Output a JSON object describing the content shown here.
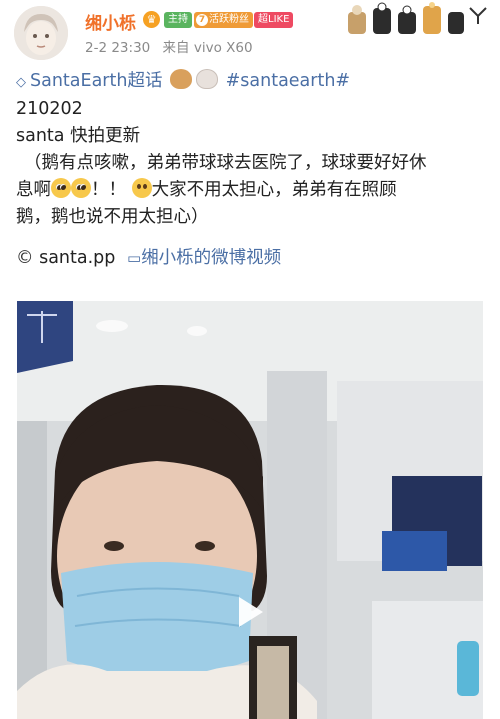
{
  "header": {
    "username": "缃小栎",
    "badges": {
      "host": "主持",
      "fan_level": "7",
      "fan_label": "活跃粉丝",
      "super": "超LIKE"
    },
    "time": "2-2 23:30",
    "source": "来自 vivo X60"
  },
  "post": {
    "topic_tag": "SantaEarth超话",
    "hashtag": "#santaearth#",
    "date_code": "210202",
    "line1": "santa 快拍更新",
    "line2": "（鹅有点咳嗽，弟弟带球球去医院了，球球要好好休",
    "line3a": "息啊",
    "line3b": "！！",
    "line3c": "大家不用太担心，弟弟有在照顾",
    "line4": "鹅，鹅也说不用太担心）",
    "credit_symbol": "©",
    "credit": "santa.pp",
    "video_link": "缃小栎的微博视频"
  },
  "colors": {
    "username": "#f0712a",
    "link": "#4b6fa5",
    "meta": "#8a8a8a"
  },
  "icons": {
    "verified": "crown-icon",
    "topic": "diamond-icon",
    "video": "video-camera-icon",
    "play": "play-icon"
  }
}
